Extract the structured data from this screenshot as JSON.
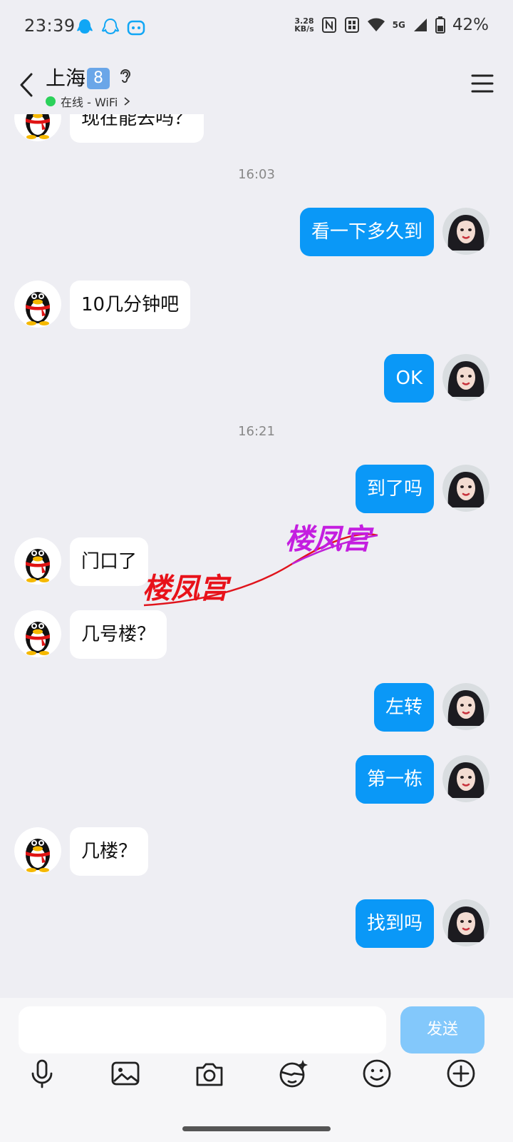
{
  "status": {
    "time": "23:39",
    "net_speed_value": "3.28",
    "net_speed_unit": "KB/s",
    "network": "5G",
    "battery": "42%"
  },
  "header": {
    "title": "上海",
    "badge": "8",
    "status_text": "在线 - WiFi"
  },
  "chat": {
    "timestamps": [
      "16:03",
      "16:21"
    ],
    "messages": [
      {
        "side": "in",
        "text": "现在能去吗？"
      },
      {
        "side": "out",
        "text": "看一下多久到"
      },
      {
        "side": "in",
        "text": "10几分钟吧"
      },
      {
        "side": "out",
        "text": "OK"
      },
      {
        "side": "out",
        "text": "到了吗"
      },
      {
        "side": "in",
        "text": "门口了"
      },
      {
        "side": "in",
        "text": "几号楼？"
      },
      {
        "side": "out",
        "text": "左转"
      },
      {
        "side": "out",
        "text": "第一栋"
      },
      {
        "side": "in",
        "text": "几楼？"
      },
      {
        "side": "out",
        "text": "找到吗"
      }
    ],
    "watermark": "楼凤宫"
  },
  "input": {
    "send_label": "发送"
  },
  "colors": {
    "outgoing_bubble": "#0a98f7",
    "incoming_bubble": "#ffffff",
    "background": "#eeeef3",
    "send_disabled": "#83c8fb"
  },
  "icons": [
    "back-icon",
    "ear-icon",
    "menu-icon",
    "mic-icon",
    "image-icon",
    "camera-icon",
    "sticker-icon",
    "emoji-icon",
    "plus-icon"
  ]
}
